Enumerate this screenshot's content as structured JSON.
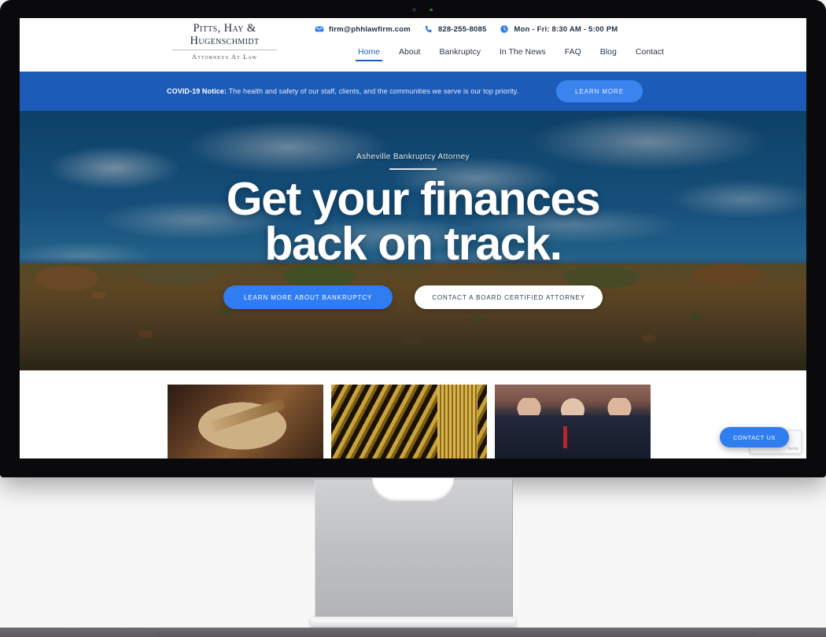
{
  "brand": {
    "logo_line1": "Pitts, Hay &",
    "logo_line2": "Hugenschmidt",
    "logo_tagline": "Attorneys At Law",
    "accent_blue": "#2f7df0",
    "banner_blue": "#1c5cb8",
    "nav_active_blue": "#1b5fc4"
  },
  "contact_bar": {
    "email": "firm@phhlawfirm.com",
    "phone": "828-255-8085",
    "hours": "Mon - Fri: 8:30 AM - 5:00 PM",
    "email_icon": "envelope-icon",
    "phone_icon": "phone-icon",
    "hours_icon": "clock-icon"
  },
  "nav": {
    "items": [
      {
        "label": "Home",
        "active": true
      },
      {
        "label": "About",
        "active": false
      },
      {
        "label": "Bankruptcy",
        "active": false
      },
      {
        "label": "In The News",
        "active": false
      },
      {
        "label": "FAQ",
        "active": false
      },
      {
        "label": "Blog",
        "active": false
      },
      {
        "label": "Contact",
        "active": false
      }
    ]
  },
  "covid_banner": {
    "label": "COVID-19 Notice:",
    "message": " The health and safety of our staff, clients, and the communities we serve is our top priority.",
    "button": "LEARN MORE"
  },
  "hero": {
    "eyebrow": "Asheville Bankruptcy Attorney",
    "headline_line1": "Get your finances",
    "headline_line2": "back on track.",
    "cta_primary": "LEARN MORE ABOUT BANKRUPTCY",
    "cta_secondary": "CONTACT A BOARD CERTIFIED ATTORNEY",
    "background": "autumn blue ridge mountains with blue sky and clouds"
  },
  "cards": [
    {
      "name": "gavel-photo",
      "alt": "Wooden judge gavel close-up"
    },
    {
      "name": "columns-photo",
      "alt": "Gold ornate classical columns"
    },
    {
      "name": "team-photo",
      "alt": "Three attorneys in suits outside brick building"
    }
  ],
  "widgets": {
    "recaptcha_terms": "Terms",
    "contact_fab": "CONTACT US"
  }
}
